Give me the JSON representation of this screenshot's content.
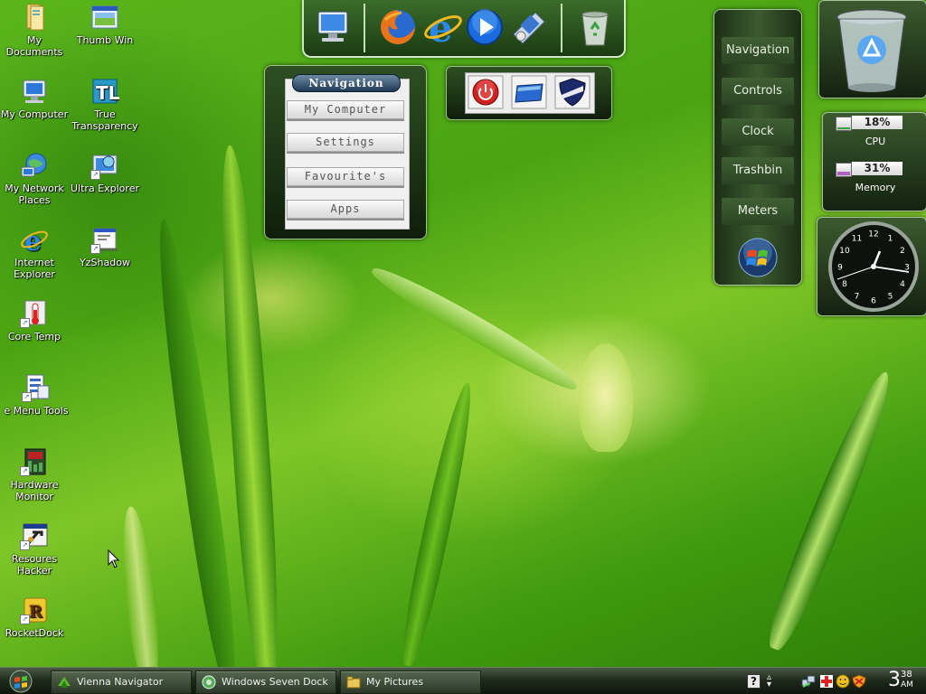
{
  "desktop_icons": [
    {
      "label": "My Documents",
      "icon": "my-documents-icon",
      "shortcut": false
    },
    {
      "label": "Thumb Win",
      "icon": "thumb-win-icon",
      "shortcut": false
    },
    {
      "label": "My Computer",
      "icon": "my-computer-icon",
      "shortcut": false
    },
    {
      "label": "True Transparency",
      "icon": "true-transparency-icon",
      "shortcut": false
    },
    {
      "label": "My Network Places",
      "icon": "network-places-icon",
      "shortcut": false
    },
    {
      "label": "Ultra Explorer",
      "icon": "ultra-explorer-icon",
      "shortcut": true
    },
    {
      "label": "Internet Explorer",
      "icon": "internet-explorer-icon",
      "shortcut": false
    },
    {
      "label": "YzShadow",
      "icon": "yzshadow-icon",
      "shortcut": true
    },
    {
      "label": "Core Temp",
      "icon": "core-temp-icon",
      "shortcut": true
    },
    {
      "label": "e Menu Tools",
      "icon": "menu-tools-icon",
      "shortcut": true
    },
    {
      "label": "Hardware Monitor",
      "icon": "hardware-monitor-icon",
      "shortcut": true
    },
    {
      "label": "Resoures Hacker",
      "icon": "resource-hacker-icon",
      "shortcut": true
    },
    {
      "label": "RocketDock",
      "icon": "rocketdock-icon",
      "shortcut": true
    }
  ],
  "dock": {
    "items": [
      "my-computer-icon",
      "firefox-icon",
      "internet-explorer-icon",
      "media-player-icon",
      "control-panel-icon",
      "recycle-bin-icon"
    ]
  },
  "navigation_panel": {
    "title": "Navigation",
    "buttons": [
      "My Computer",
      "Settings",
      "Favourite's",
      "Apps"
    ]
  },
  "controls_panel": {
    "buttons": [
      "power-icon",
      "window-icon",
      "security-shield-icon"
    ]
  },
  "side_panel": {
    "items": [
      "Navigation",
      "Controls",
      "Clock",
      "Trashbin",
      "Meters"
    ],
    "logo": "windows-orb-icon"
  },
  "meters": {
    "cpu": {
      "value": "18%",
      "label": "CPU",
      "level": 0.18
    },
    "memory": {
      "value": "31%",
      "label": "Memory",
      "level": 0.31
    }
  },
  "clock_gadget": {
    "numbers": [
      "12",
      "1",
      "2",
      "3",
      "4",
      "5",
      "6",
      "7",
      "8",
      "9",
      "10",
      "11"
    ]
  },
  "taskbar": {
    "buttons": [
      {
        "label": "Vienna Navigator",
        "icon": "vienna-icon"
      },
      {
        "label": "Windows Seven Dock",
        "icon": "dock-app-icon"
      },
      {
        "label": "My Pictures",
        "icon": "folder-icon"
      }
    ],
    "tray_icons": [
      "help-icon",
      "up-arrow-icon",
      "network-icon",
      "red-cross-icon",
      "smiley-icon",
      "shield-tray-icon"
    ],
    "clock_hour": "3",
    "clock_minutes": "38",
    "clock_ampm": "AM"
  },
  "colors": {
    "wallpaper": "#4aa412",
    "panel_dark": "#1c2e16",
    "meter_cpu": "#3aa040",
    "meter_memory": "#b060c0"
  }
}
